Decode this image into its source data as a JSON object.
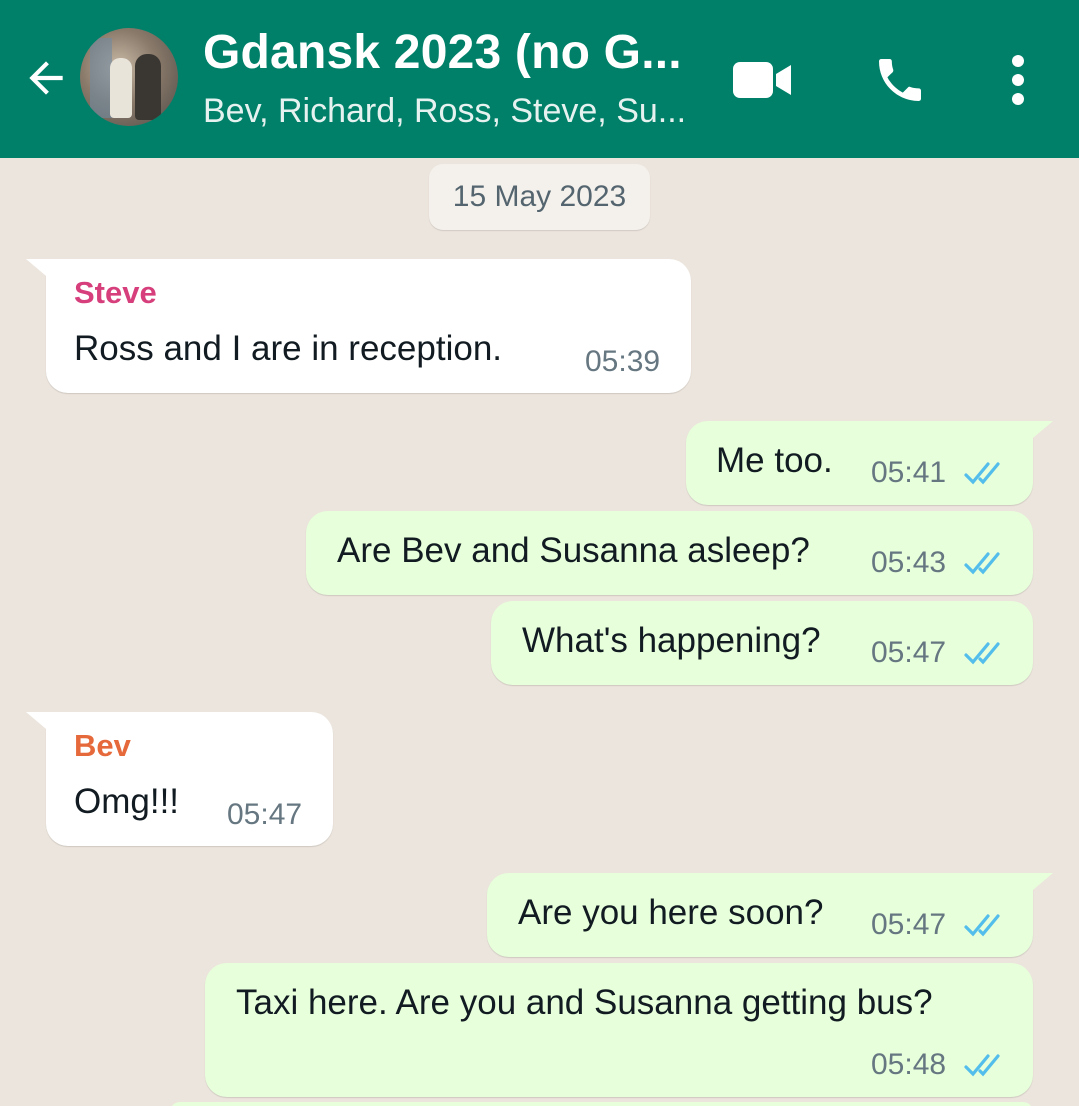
{
  "header": {
    "title": "Gdansk 2023 (no G...",
    "subtitle": "Bev, Richard, Ross, Steve, Su..."
  },
  "chat": {
    "date": "15 May 2023",
    "messages": [
      {
        "sender": "Steve",
        "text": "Ross and I are in reception.",
        "time": "05:39",
        "direction": "incoming",
        "sender_color": "#d63f7c"
      },
      {
        "text": "Me too.",
        "time": "05:41",
        "direction": "outgoing",
        "read": true
      },
      {
        "text": "Are Bev and Susanna asleep?",
        "time": "05:43",
        "direction": "outgoing",
        "read": true
      },
      {
        "text": "What's happening?",
        "time": "05:47",
        "direction": "outgoing",
        "read": true
      },
      {
        "sender": "Bev",
        "text": "Omg!!!",
        "time": "05:47",
        "direction": "incoming",
        "sender_color": "#e5693a"
      },
      {
        "text": "Are you here soon?",
        "time": "05:47",
        "direction": "outgoing",
        "read": true
      },
      {
        "text": "Taxi here. Are you and Susanna getting bus?",
        "time": "05:48",
        "direction": "outgoing",
        "read": true
      }
    ]
  },
  "colors": {
    "header": "#008069",
    "background": "#ece5dd",
    "outgoing_bubble": "#e7ffdb",
    "incoming_bubble": "#ffffff",
    "read_ticks": "#53bdeb"
  },
  "icons": [
    "back-arrow-icon",
    "video-call-icon",
    "phone-icon",
    "more-options-icon",
    "double-check-icon"
  ]
}
